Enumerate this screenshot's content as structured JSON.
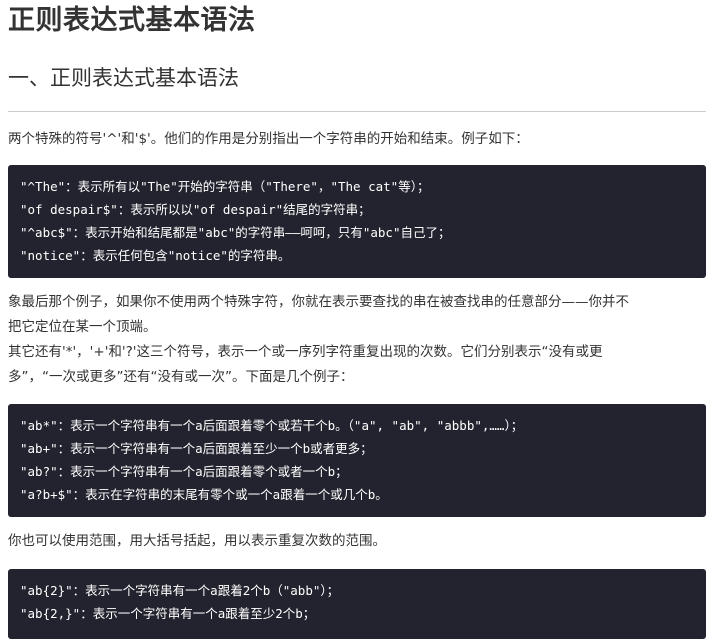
{
  "title": "正则表达式基本语法",
  "section_heading": "一、正则表达式基本语法",
  "paragraphs": {
    "intro": "两个特殊的符号'^'和'$'。他们的作用是分别指出一个字符串的开始和结束。例子如下：",
    "after_first_block_line1": "象最后那个例子，如果你不使用两个特殊字符，你就在表示要查找的串在被查找串的任意部分——你并不",
    "after_first_block_line2": "把它定位在某一个顶端。",
    "repeat_line1": "其它还有'*'，'+'和'?'这三个符号，表示一个或一序列字符重复出现的次数。它们分别表示“没有或更",
    "repeat_line2": "多”，“一次或更多”还有“没有或一次”。下面是几个例子：",
    "range": "你也可以使用范围，用大括号括起，用以表示重复次数的范围。"
  },
  "code_blocks": [
    {
      "lines": [
        "\"^The\"：表示所有以\"The\"开始的字符串（\"There\"，\"The cat\"等）；",
        "\"of despair$\"：表示所以以\"of despair\"结尾的字符串；",
        "\"^abc$\"：表示开始和结尾都是\"abc\"的字符串——呵呵，只有\"abc\"自己了；",
        "\"notice\"：表示任何包含\"notice\"的字符串。"
      ]
    },
    {
      "lines": [
        "\"ab*\"：表示一个字符串有一个a后面跟着零个或若干个b。（\"a\", \"ab\", \"abbb\",……）；",
        "\"ab+\"：表示一个字符串有一个a后面跟着至少一个b或者更多；",
        "\"ab?\"：表示一个字符串有一个a后面跟着零个或者一个b；",
        "\"a?b+$\"：表示在字符串的末尾有零个或一个a跟着一个或几个b。"
      ]
    },
    {
      "lines": [
        "\"ab{2}\"：表示一个字符串有一个a跟着2个b（\"abb\"）；",
        "\"ab{2,}\"：表示一个字符串有一个a跟着至少2个b；"
      ]
    }
  ]
}
